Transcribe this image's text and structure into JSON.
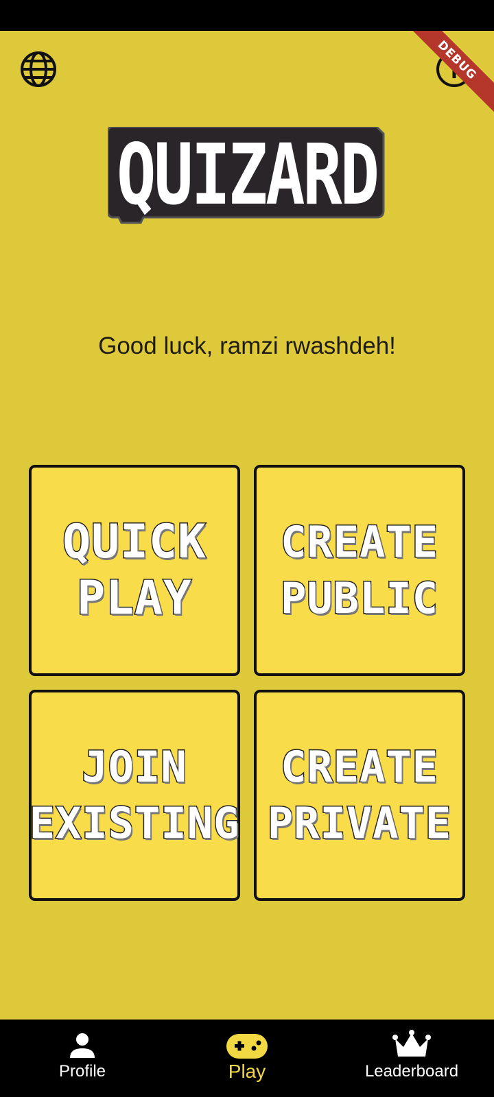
{
  "header": {
    "globe_icon": "globe-icon",
    "info_icon": "info-icon",
    "debug_label": "DEBUG"
  },
  "logo": {
    "text": "QUIZARD"
  },
  "greeting": "Good luck, ramzi rwashdeh!",
  "tiles": [
    {
      "line1": "QUICK",
      "line2": "PLAY"
    },
    {
      "line1": "CREATE",
      "line2": "PUBLIC"
    },
    {
      "line1": "JOIN",
      "line2": "EXISTING"
    },
    {
      "line1": "CREATE",
      "line2": "PRIVATE"
    }
  ],
  "nav": {
    "items": [
      {
        "label": "Profile",
        "icon": "person-icon"
      },
      {
        "label": "Play",
        "icon": "gamepad-icon",
        "active": true
      },
      {
        "label": "Leaderboard",
        "icon": "crown-icon"
      }
    ]
  },
  "colors": {
    "background": "#ddc93a",
    "tile": "#f9dc49",
    "active_nav": "#f2d943",
    "debug_ribbon": "#b5372b"
  }
}
